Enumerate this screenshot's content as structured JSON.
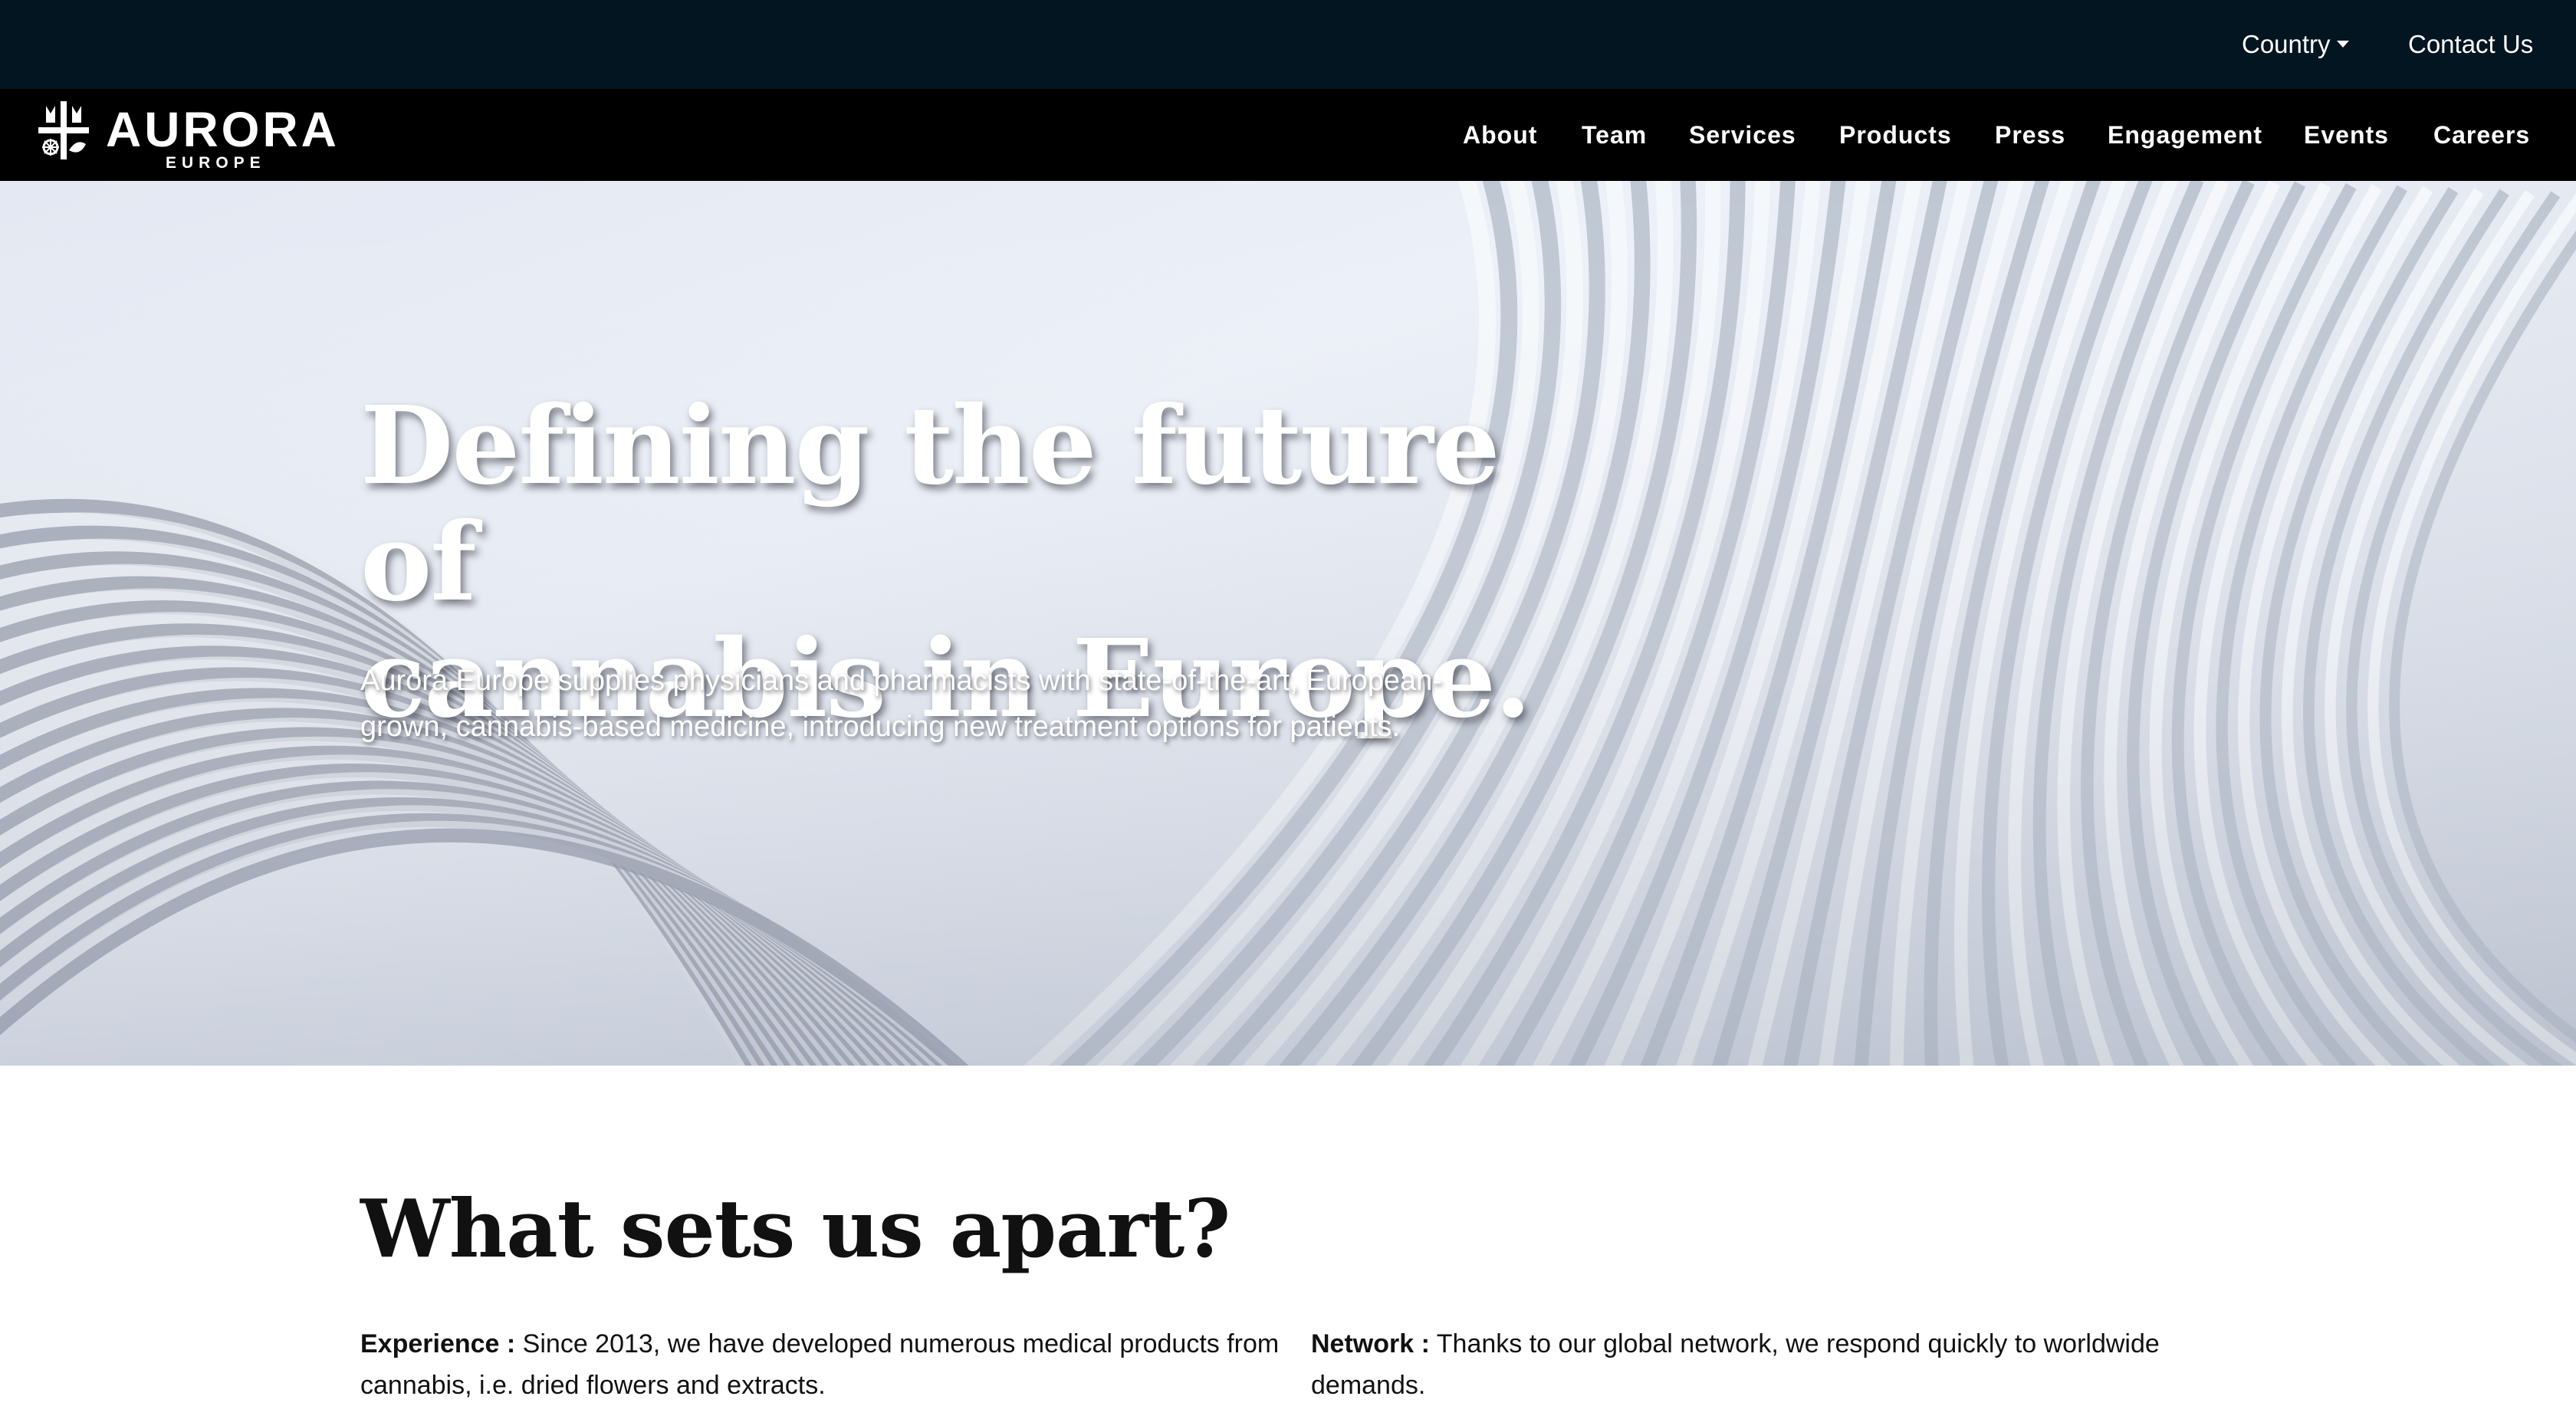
{
  "topbar": {
    "country_label": "Country",
    "contact_label": "Contact Us"
  },
  "brand": {
    "name": "AURORA",
    "subtitle": "EUROPE"
  },
  "nav": {
    "items": [
      {
        "label": "About"
      },
      {
        "label": "Team"
      },
      {
        "label": "Services"
      },
      {
        "label": "Products"
      },
      {
        "label": "Press"
      },
      {
        "label": "Engagement"
      },
      {
        "label": "Events"
      },
      {
        "label": "Careers"
      }
    ]
  },
  "hero": {
    "title_line1": "Defining the future of",
    "title_line2": "cannabis in Europe.",
    "subtitle": "Aurora Europe supplies physicians and pharmacists with state-of-the-art, European-grown, cannabis-based medicine, introducing new treatment options for patients."
  },
  "apart": {
    "title": "What sets us apart?",
    "features": [
      {
        "label": "Experience :",
        "text": "Since 2013, we have developed numerous medical products from cannabis, i.e. dried flowers and extracts."
      },
      {
        "label": "Network :",
        "text": "Thanks to our global network, we respond quickly to worldwide demands."
      }
    ]
  },
  "colors": {
    "topbar_bg": "#021520",
    "navbar_bg": "#000000",
    "hero_text": "#ffffff"
  }
}
